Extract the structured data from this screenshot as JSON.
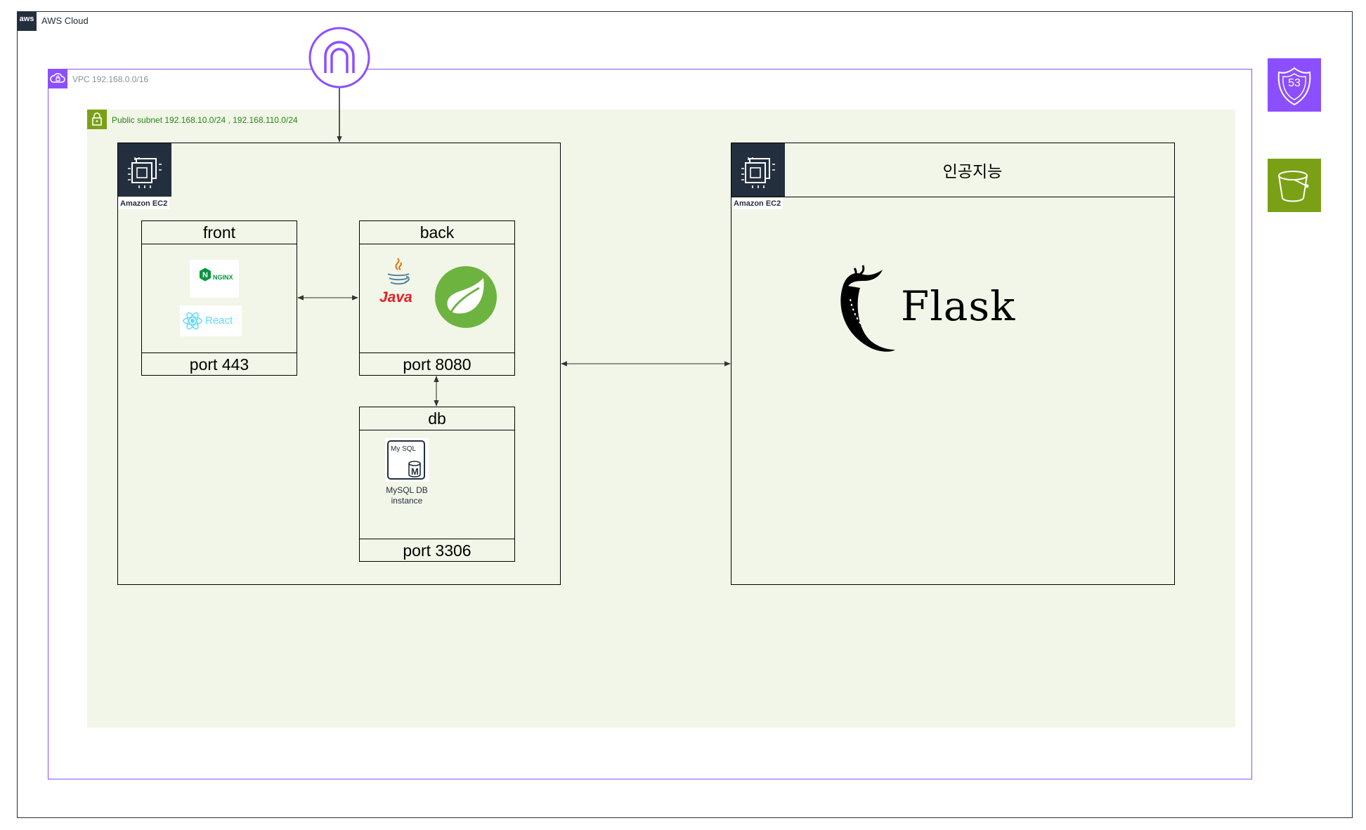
{
  "aws_cloud": {
    "label": "AWS Cloud",
    "logo_text": "aws",
    "border_color": "#232F3E"
  },
  "vpc": {
    "label": "VPC  192.168.0.0/16",
    "color": "#8C4FFF"
  },
  "subnet": {
    "label": "Public subnet 192.168.10.0/24 , 192.168.110.0/24",
    "color": "#7AA116",
    "fill": "#F2F6E8"
  },
  "internet_gateway": {
    "icon": "internet-gateway-icon",
    "color": "#8C4FFF"
  },
  "ec2_backend": {
    "caption": "Amazon EC2",
    "front": {
      "title": "front",
      "port": "port 443",
      "logos": {
        "nginx": "NGINX",
        "react": "React"
      }
    },
    "back": {
      "title": "back",
      "port": "port 8080",
      "logos": {
        "java": "Java",
        "spring": "spring-leaf-icon"
      }
    },
    "db": {
      "title": "db",
      "port": "port 3306",
      "mysql_icon_text": "My SQL",
      "mysql_badge": "M",
      "mysql_label": "MySQL DB instance"
    }
  },
  "ec2_ai": {
    "caption": "Amazon EC2",
    "title": "인공지능",
    "flask_text": "Flask"
  },
  "side_services": [
    {
      "name": "Route 53",
      "icon": "route53-icon",
      "text": "53",
      "color": "#8C4FFF"
    },
    {
      "name": "S3",
      "icon": "s3-bucket-icon",
      "color": "#7AA116"
    }
  ]
}
